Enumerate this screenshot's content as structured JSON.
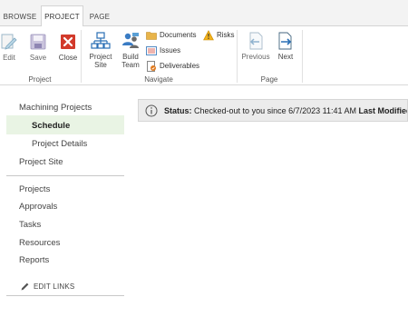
{
  "tabs": [
    {
      "label": "BROWSE"
    },
    {
      "label": "PROJECT"
    },
    {
      "label": "PAGE"
    }
  ],
  "ribbon": {
    "project_group": {
      "label": "Project",
      "edit": "Edit",
      "save": "Save",
      "close": "Close"
    },
    "navigate_group": {
      "label": "Navigate",
      "project_site": [
        "Project",
        "Site"
      ],
      "build_team": [
        "Build",
        "Team"
      ],
      "documents": "Documents",
      "issues": "Issues",
      "deliverables": "Deliverables",
      "risks": "Risks"
    },
    "page_group": {
      "label": "Page",
      "previous": "Previous",
      "next": "Next"
    }
  },
  "nav": {
    "items": [
      {
        "label": "Machining Projects"
      },
      {
        "label": "Schedule"
      },
      {
        "label": "Project Details"
      },
      {
        "label": "Project Site"
      },
      {
        "label": "Projects"
      },
      {
        "label": "Approvals"
      },
      {
        "label": "Tasks"
      },
      {
        "label": "Resources"
      },
      {
        "label": "Reports"
      }
    ],
    "edit_links": "EDIT LINKS"
  },
  "status": {
    "label": "Status:",
    "text": "Checked-out to you since 6/7/2023 11:41 AM",
    "label2": "Last Modified"
  },
  "colors": {
    "selected_nav_bg": "#e9f4e4",
    "close_red": "#d23a2b",
    "accent_blue": "#2a6fb5"
  }
}
